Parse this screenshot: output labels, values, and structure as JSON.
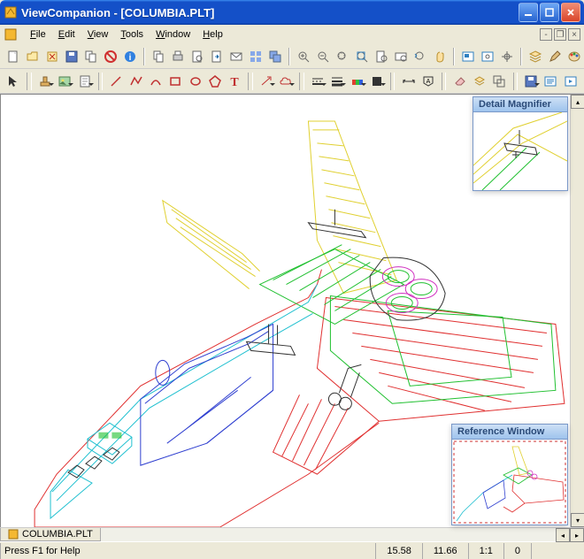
{
  "window": {
    "title": "ViewCompanion - [COLUMBIA.PLT]"
  },
  "menu": {
    "items": [
      "File",
      "Edit",
      "View",
      "Tools",
      "Window",
      "Help"
    ]
  },
  "document": {
    "tab": "COLUMBIA.PLT"
  },
  "panels": {
    "magnifier": "Detail Magnifier",
    "reference": "Reference Window"
  },
  "status": {
    "help": "Press F1 for Help",
    "x": "15.58",
    "y": "11.66",
    "zoom": "1:1",
    "rot": "0"
  },
  "colors": {
    "titlebar": "#1450c8"
  }
}
